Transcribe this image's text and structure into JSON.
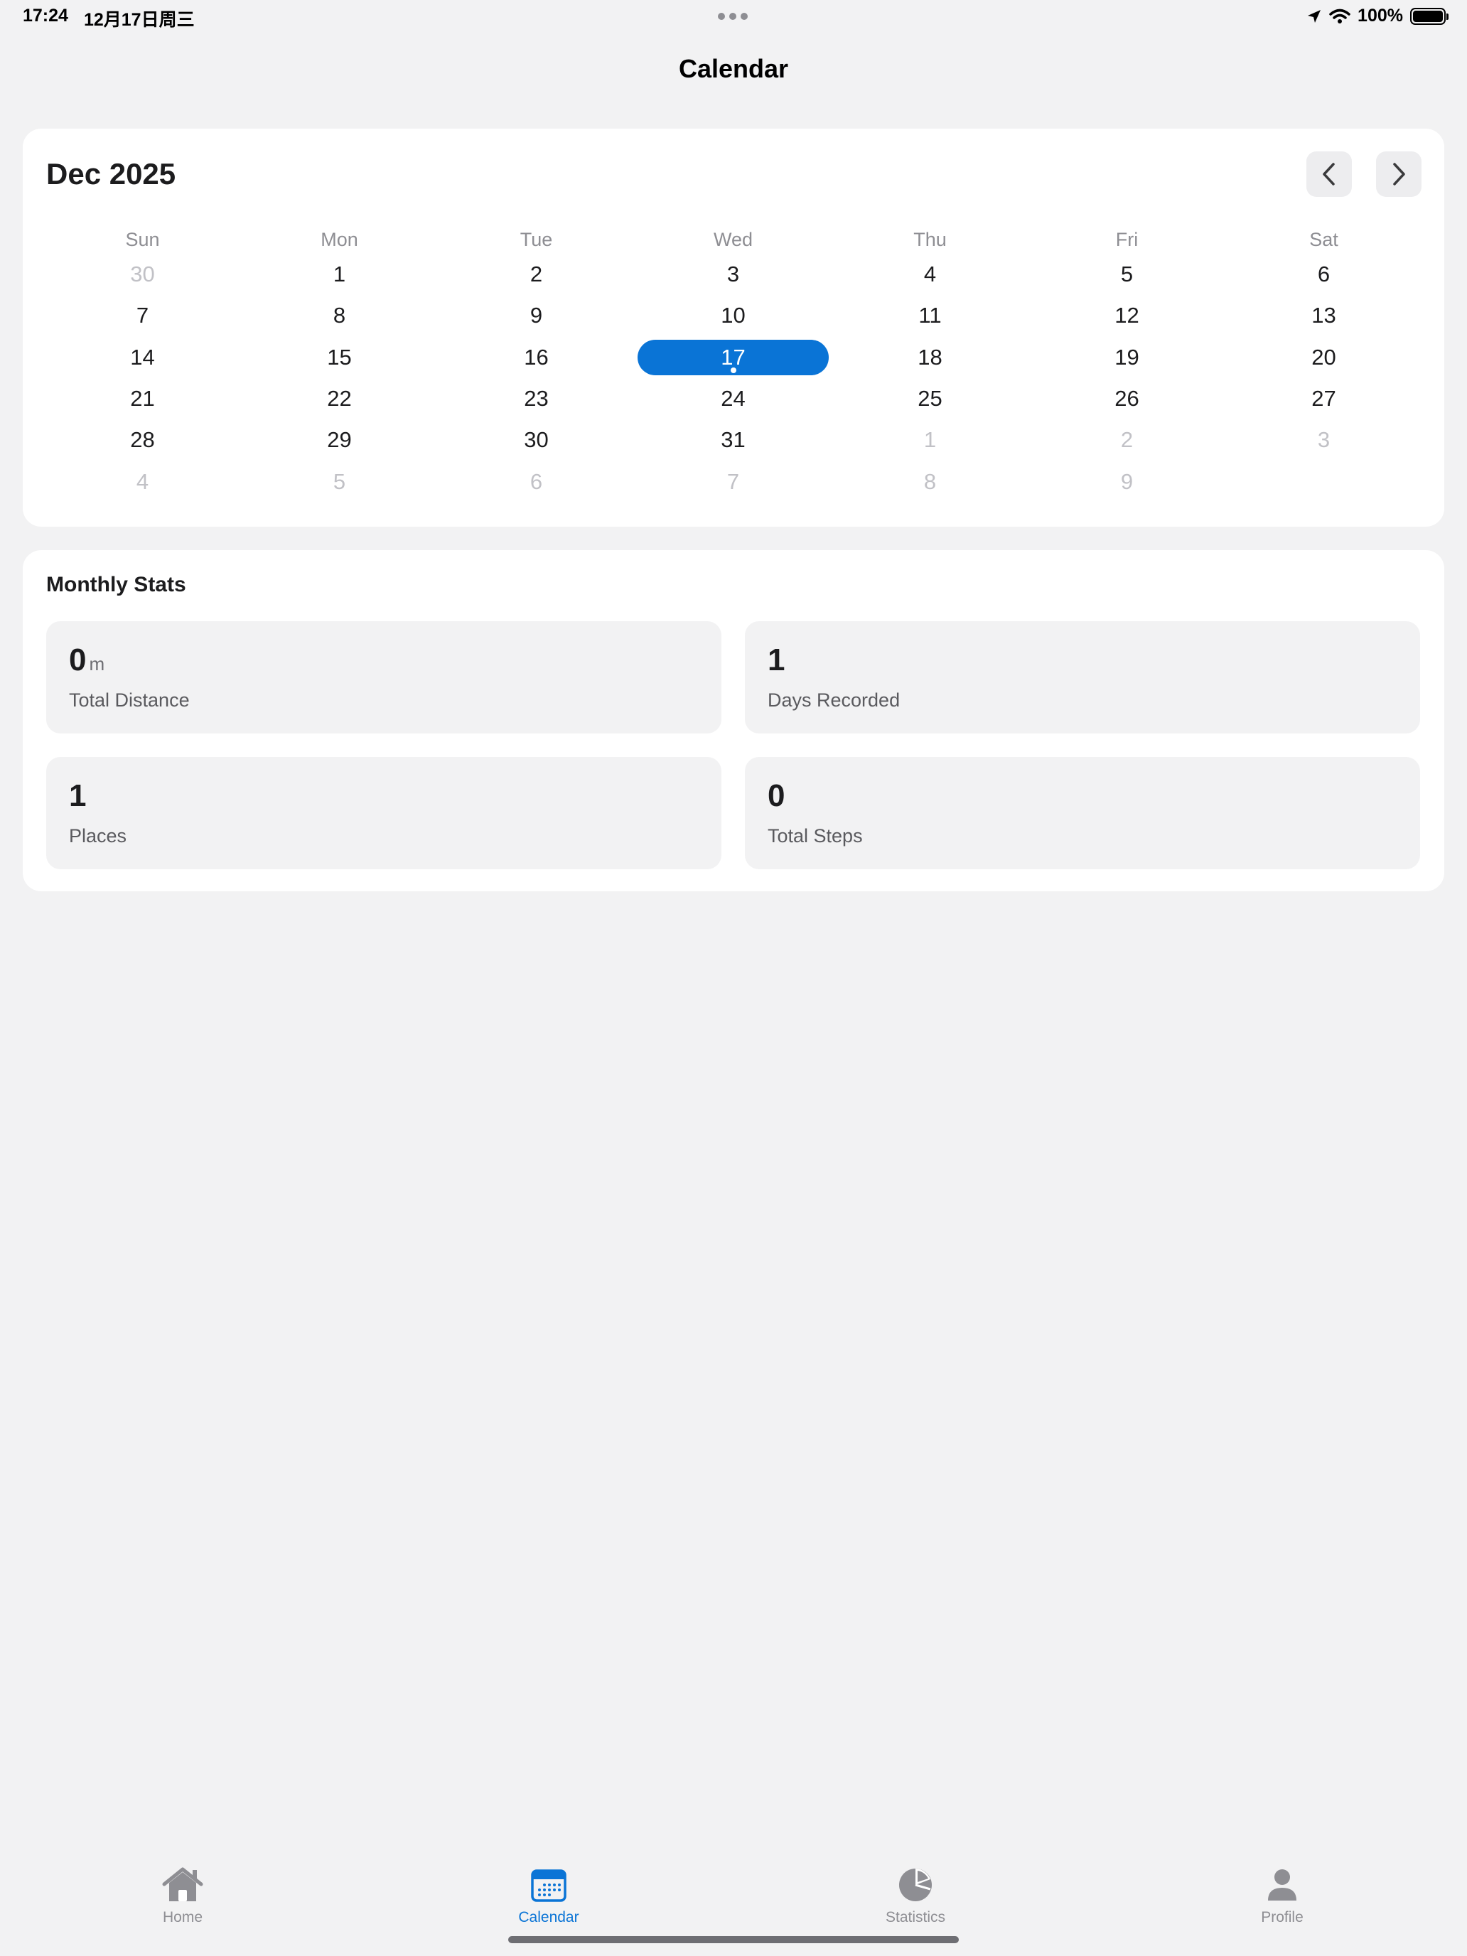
{
  "status": {
    "time": "17:24",
    "date": "12月17日周三",
    "battery": "100%"
  },
  "nav": {
    "title": "Calendar"
  },
  "calendar": {
    "month_label": "Dec 2025",
    "weekdays": [
      "Sun",
      "Mon",
      "Tue",
      "Wed",
      "Thu",
      "Fri",
      "Sat"
    ],
    "weeks": [
      [
        "30",
        "1",
        "2",
        "3",
        "4",
        "5",
        "6"
      ],
      [
        "7",
        "8",
        "9",
        "10",
        "11",
        "12",
        "13"
      ],
      [
        "14",
        "15",
        "16",
        "17",
        "18",
        "19",
        "20"
      ],
      [
        "21",
        "22",
        "23",
        "24",
        "25",
        "26",
        "27"
      ],
      [
        "28",
        "29",
        "30",
        "31",
        "1",
        "2",
        "3"
      ],
      [
        "4",
        "5",
        "6",
        "7",
        "8",
        "9",
        ""
      ]
    ],
    "selected_day": "17",
    "accent_color": "#0a74d6"
  },
  "stats": {
    "title": "Monthly Stats",
    "items": [
      {
        "value": "0",
        "unit": "m",
        "label": "Total Distance"
      },
      {
        "value": "1",
        "unit": "",
        "label": "Days Recorded"
      },
      {
        "value": "1",
        "unit": "",
        "label": "Places"
      },
      {
        "value": "0",
        "unit": "",
        "label": "Total Steps"
      }
    ]
  },
  "tabs": [
    {
      "label": "Home",
      "icon": "home-icon"
    },
    {
      "label": "Calendar",
      "icon": "calendar-icon",
      "active": true
    },
    {
      "label": "Statistics",
      "icon": "pie-chart-icon"
    },
    {
      "label": "Profile",
      "icon": "person-icon"
    }
  ]
}
